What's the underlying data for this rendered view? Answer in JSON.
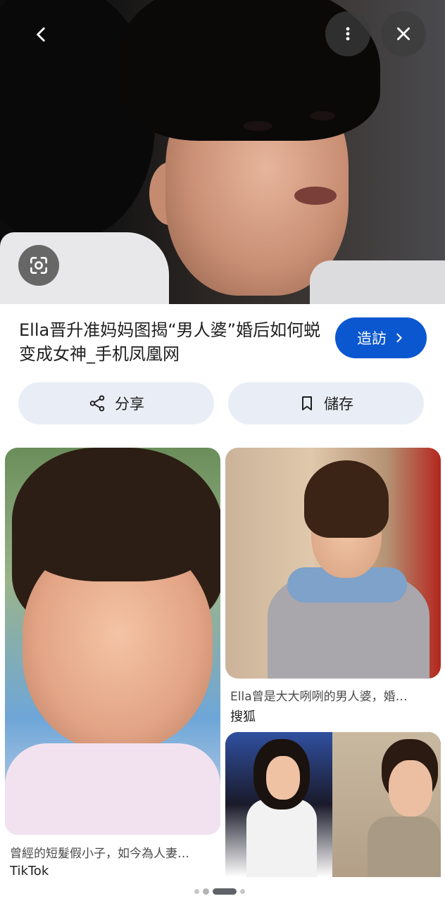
{
  "hero": {
    "back_icon": "arrow-left-icon",
    "more_icon": "more-vertical-icon",
    "close_icon": "close-icon",
    "lens_icon": "lens-search-icon"
  },
  "result": {
    "title": "Ella晋升准妈妈图揭“男人婆”婚后如何蜕变成女神_手机凤凰网",
    "visit_label": "造訪",
    "share_label": "分享",
    "save_label": "儲存"
  },
  "related": [
    {
      "caption": "曾經的短髮假小子，如今為人妻…",
      "source": "TikTok"
    },
    {
      "caption": "Ella曾是大大咧咧的男人婆，婚…",
      "source": "搜狐"
    },
    {
      "caption": "",
      "source": ""
    }
  ],
  "pager": {
    "count": 5,
    "active": 2
  },
  "colors": {
    "accent": "#0b57d0",
    "pill_bg": "#e9eef6"
  }
}
